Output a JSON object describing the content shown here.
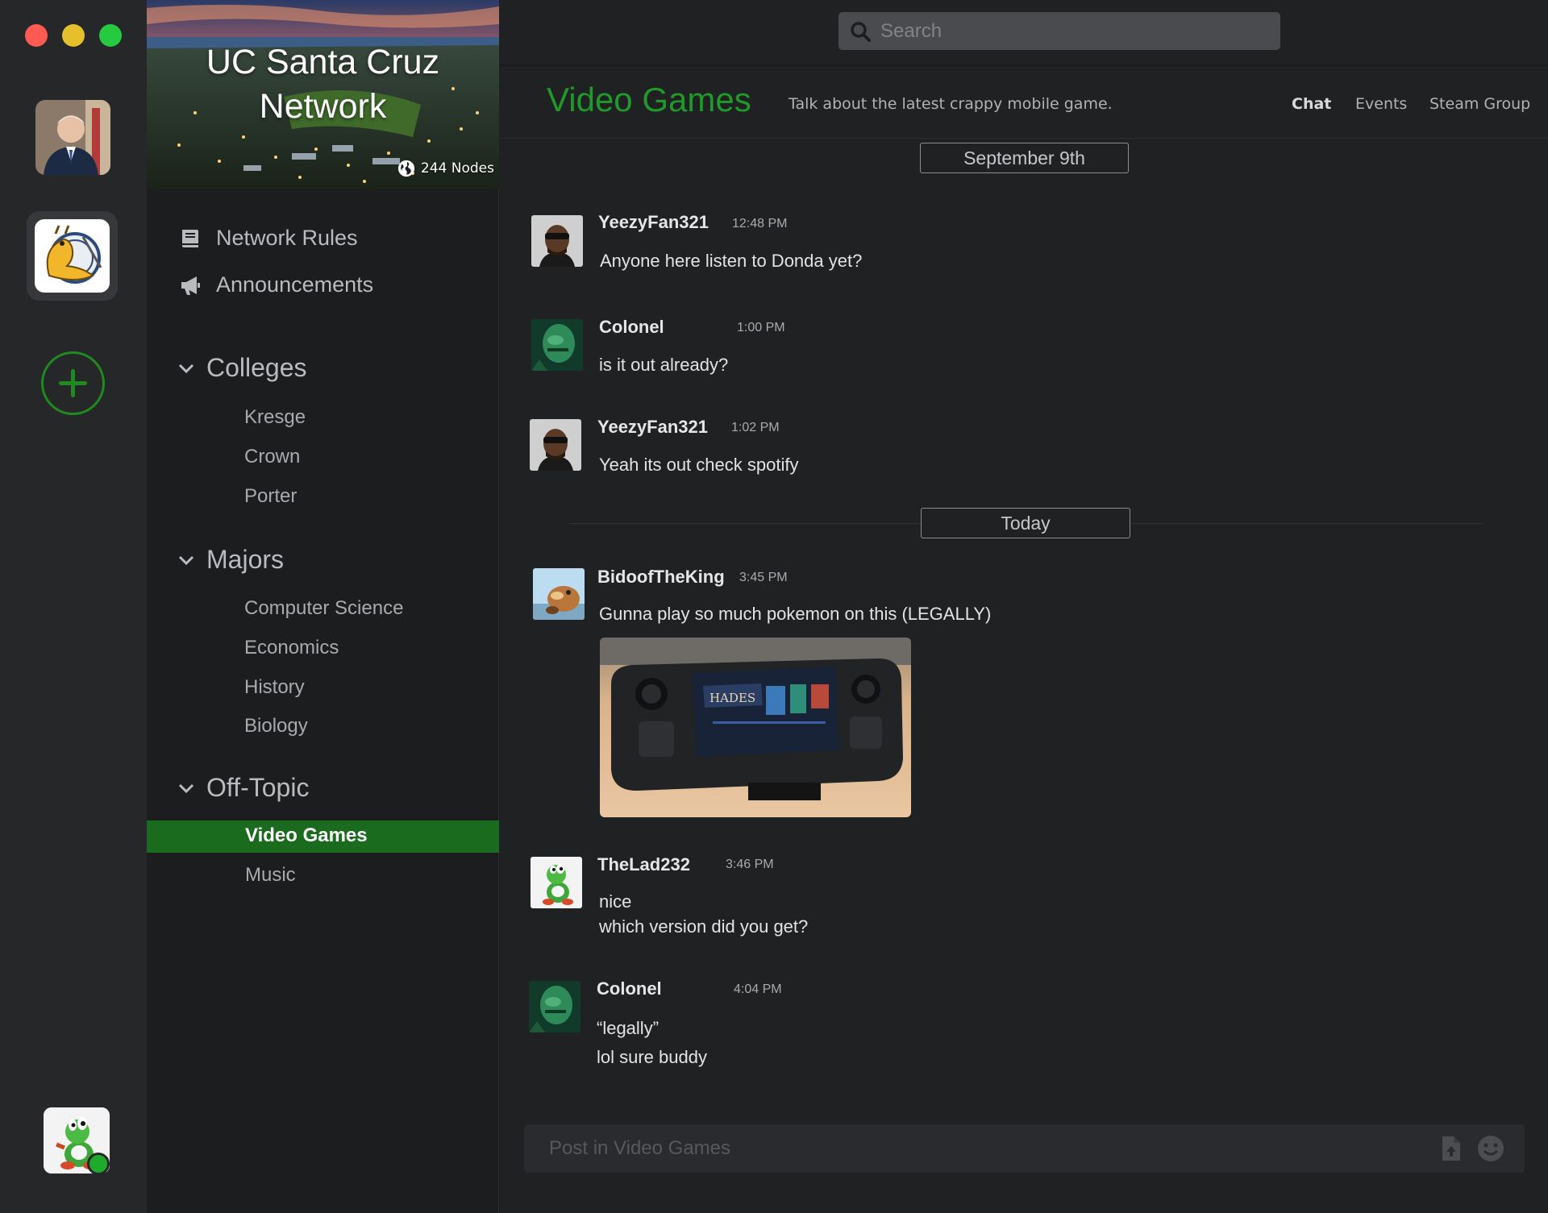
{
  "window": {
    "controls": [
      "close",
      "minimize",
      "maximize"
    ]
  },
  "servers": [
    {
      "name": "user-profile-server",
      "icon": "portrait-avatar"
    },
    {
      "name": "ucsc-server",
      "icon": "banana-slug-seal",
      "selected": true
    },
    {
      "name": "add-server",
      "icon": "plus-icon"
    }
  ],
  "network": {
    "name": "UC Santa Cruz Network",
    "nodes_label": "244 Nodes",
    "nodes_icon": "globe-icon"
  },
  "sidebar": {
    "links": [
      {
        "label": "Network Rules",
        "icon": "book-icon"
      },
      {
        "label": "Announcements",
        "icon": "megaphone-icon"
      }
    ],
    "categories": [
      {
        "label": "Colleges",
        "channels": [
          "Kresge",
          "Crown",
          "Porter"
        ]
      },
      {
        "label": "Majors",
        "channels": [
          "Computer Science",
          "Economics",
          "History",
          "Biology"
        ]
      },
      {
        "label": "Off-Topic",
        "channels": [
          "Video Games",
          "Music"
        ],
        "active": "Video Games"
      }
    ]
  },
  "search": {
    "placeholder": "Search"
  },
  "channel": {
    "title": "Video Games",
    "description": "Talk about the latest crappy mobile game.",
    "tabs": [
      "Chat",
      "Events",
      "Steam Group"
    ],
    "active_tab": "Chat"
  },
  "date_separators": [
    "September 9th",
    "Today"
  ],
  "messages": [
    {
      "author": "YeezyFan321",
      "time": "12:48 PM",
      "text": "Anyone here listen to Donda yet?"
    },
    {
      "author": "Colonel",
      "time": "1:00 PM",
      "text": "is it out already?"
    },
    {
      "author": "YeezyFan321",
      "time": "1:02 PM",
      "text": "Yeah its out check spotify"
    },
    {
      "author": "BidoofTheKing",
      "time": "3:45 PM",
      "text": "Gunna play so much pokemon on this (LEGALLY)",
      "attachment": "handheld-console-photo"
    },
    {
      "author": "TheLad232",
      "time": "3:46 PM",
      "text": "nice\nwhich version did you get?"
    },
    {
      "author": "Colonel",
      "time": "4:04 PM",
      "text": "“legally”\nlol sure buddy"
    }
  ],
  "composer": {
    "placeholder": "Post in Video Games",
    "buttons": [
      "upload-file-icon",
      "emoji-icon"
    ]
  },
  "colors": {
    "accent": "#1f9a2a",
    "active_channel_bg": "#1b6b1e",
    "online": "#1faa2b",
    "background": "#202123",
    "sidebar": "#1c1d1f"
  }
}
